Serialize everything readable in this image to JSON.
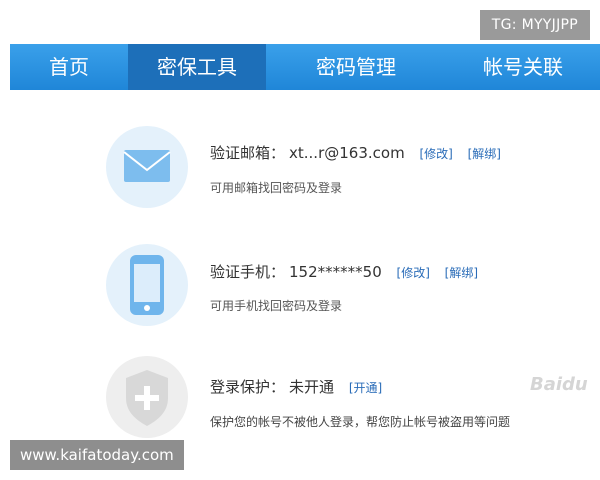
{
  "overlay": {
    "tg_tag": "TG: MYYJJPP",
    "site_tag": "www.kaifatoday.com",
    "watermark": "Baidu"
  },
  "nav": {
    "items": [
      {
        "label": "首页"
      },
      {
        "label": "密保工具",
        "active": true
      },
      {
        "label": "密码管理"
      },
      {
        "label": "帐号关联"
      }
    ]
  },
  "security": {
    "email": {
      "label": "验证邮箱：",
      "value": "xt...r@163.com",
      "edit": "[修改]",
      "unbind": "[解绑]",
      "desc": "可用邮箱找回密码及登录",
      "icon": "envelope-icon"
    },
    "phone": {
      "label": "验证手机：",
      "value": "152******50",
      "edit": "[修改]",
      "unbind": "[解绑]",
      "desc": "可用手机找回密码及登录",
      "icon": "mobile-phone-icon"
    },
    "login_protect": {
      "label": "登录保护：",
      "value": "未开通",
      "enable": "[开通]",
      "desc": "保护您的帐号不被他人登录，帮您防止帐号被盗用等问题",
      "icon": "shield-plus-icon"
    }
  },
  "colors": {
    "nav_bg": "#2a91e0",
    "nav_active": "#1d6fb9",
    "link": "#2a6cb8",
    "icon_blue": "#6fb5ec"
  }
}
